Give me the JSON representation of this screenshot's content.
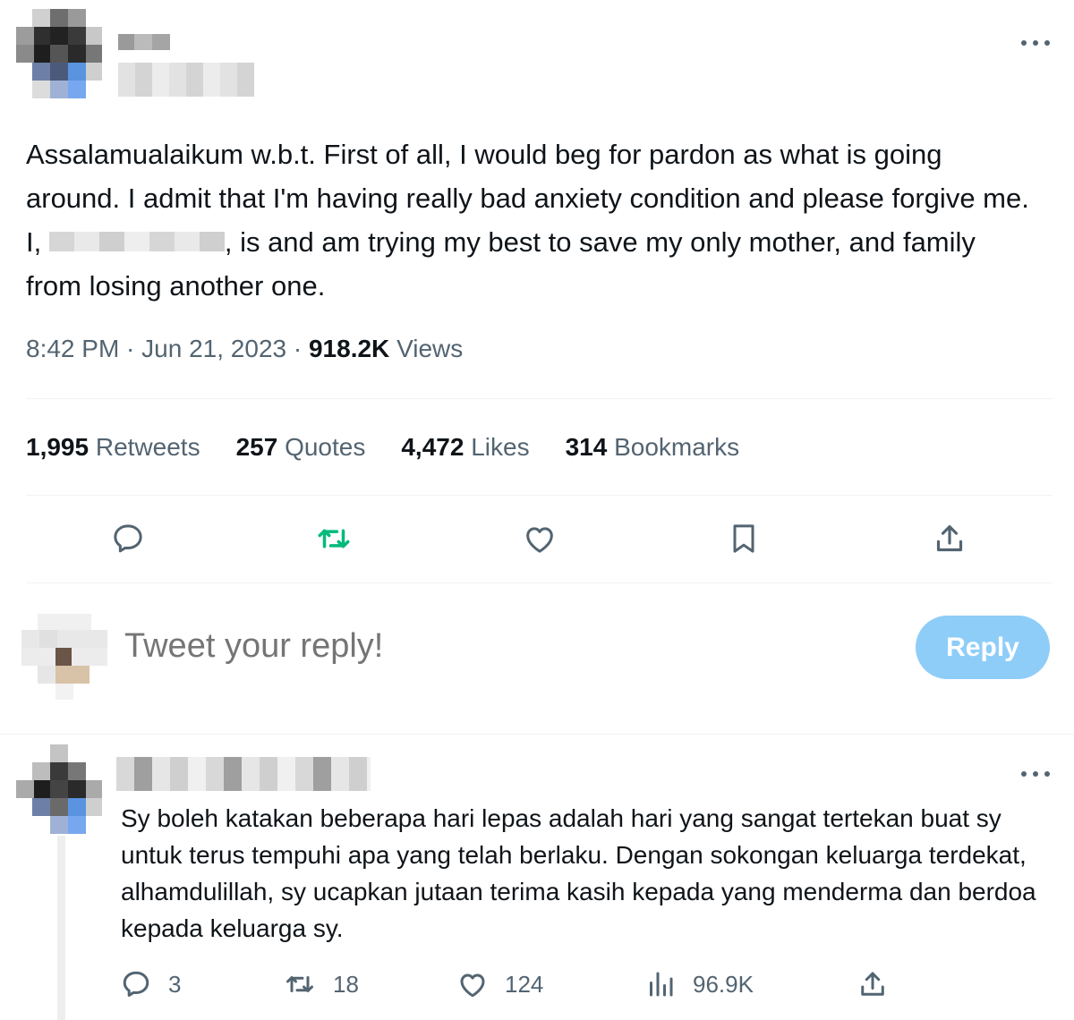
{
  "tweet": {
    "text_before": "Assalamualaikum w.b.t. First of all, I would beg for pardon as what is going around. I admit that I'm having really bad anxiety condition and please forgive me. I, ",
    "text_after": ", is and am trying my best to save my only mother, and family from losing another one.",
    "time": "8:42 PM",
    "date": "Jun 21, 2023",
    "views_count": "918.2K",
    "views_label": "Views"
  },
  "stats": [
    {
      "count": "1,995",
      "label": "Retweets"
    },
    {
      "count": "257",
      "label": "Quotes"
    },
    {
      "count": "4,472",
      "label": "Likes"
    },
    {
      "count": "314",
      "label": "Bookmarks"
    }
  ],
  "actions": [
    "reply-icon",
    "retweet-icon",
    "like-icon",
    "bookmark-icon",
    "share-icon"
  ],
  "compose": {
    "placeholder": "Tweet your reply!",
    "button_label": "Reply"
  },
  "reply": {
    "text": "Sy boleh katakan beberapa hari lepas adalah hari yang sangat tertekan buat sy untuk terus tempuhi apa yang telah berlaku. Dengan sokongan keluarga terdekat, alhamdulillah, sy ucapkan jutaan terima kasih kepada yang menderma dan berdoa kepada keluarga sy.",
    "replies": "3",
    "retweets": "18",
    "likes": "124",
    "views": "96.9K"
  },
  "colors": {
    "text": "#0f1419",
    "secondary": "#536471",
    "retweet_green": "#00ba7c",
    "reply_button": "#8ecdf8",
    "divider": "#eff3f4"
  }
}
